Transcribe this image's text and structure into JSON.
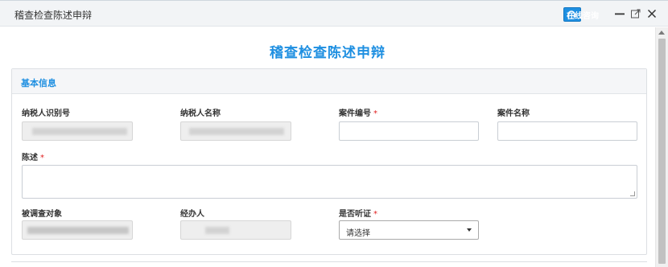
{
  "window": {
    "title": "稽查检查陈述申辩",
    "consult_label": "在线咨询"
  },
  "page": {
    "heading": "稽查检查陈述申辩"
  },
  "panel": {
    "header": "基本信息"
  },
  "fields": {
    "taxpayer_id": {
      "label": "纳税人识别号",
      "value": ""
    },
    "taxpayer_name": {
      "label": "纳税人名称",
      "value": ""
    },
    "case_no": {
      "label": "案件编号",
      "value": ""
    },
    "case_name": {
      "label": "案件名称",
      "value": ""
    },
    "statement": {
      "label": "陈述",
      "value": ""
    },
    "investigated": {
      "label": "被调查对象",
      "value": ""
    },
    "handler": {
      "label": "经办人",
      "value": ""
    },
    "hearing": {
      "label": "是否听证",
      "selected": "请选择"
    }
  },
  "required_mark": "*",
  "colors": {
    "accent": "#1e8fe1",
    "required": "#e02020",
    "header_bg": "#f2f4f6"
  },
  "icons": [
    "headset-icon",
    "minimize-icon",
    "maximize-icon",
    "close-icon",
    "chevron-down-icon"
  ]
}
